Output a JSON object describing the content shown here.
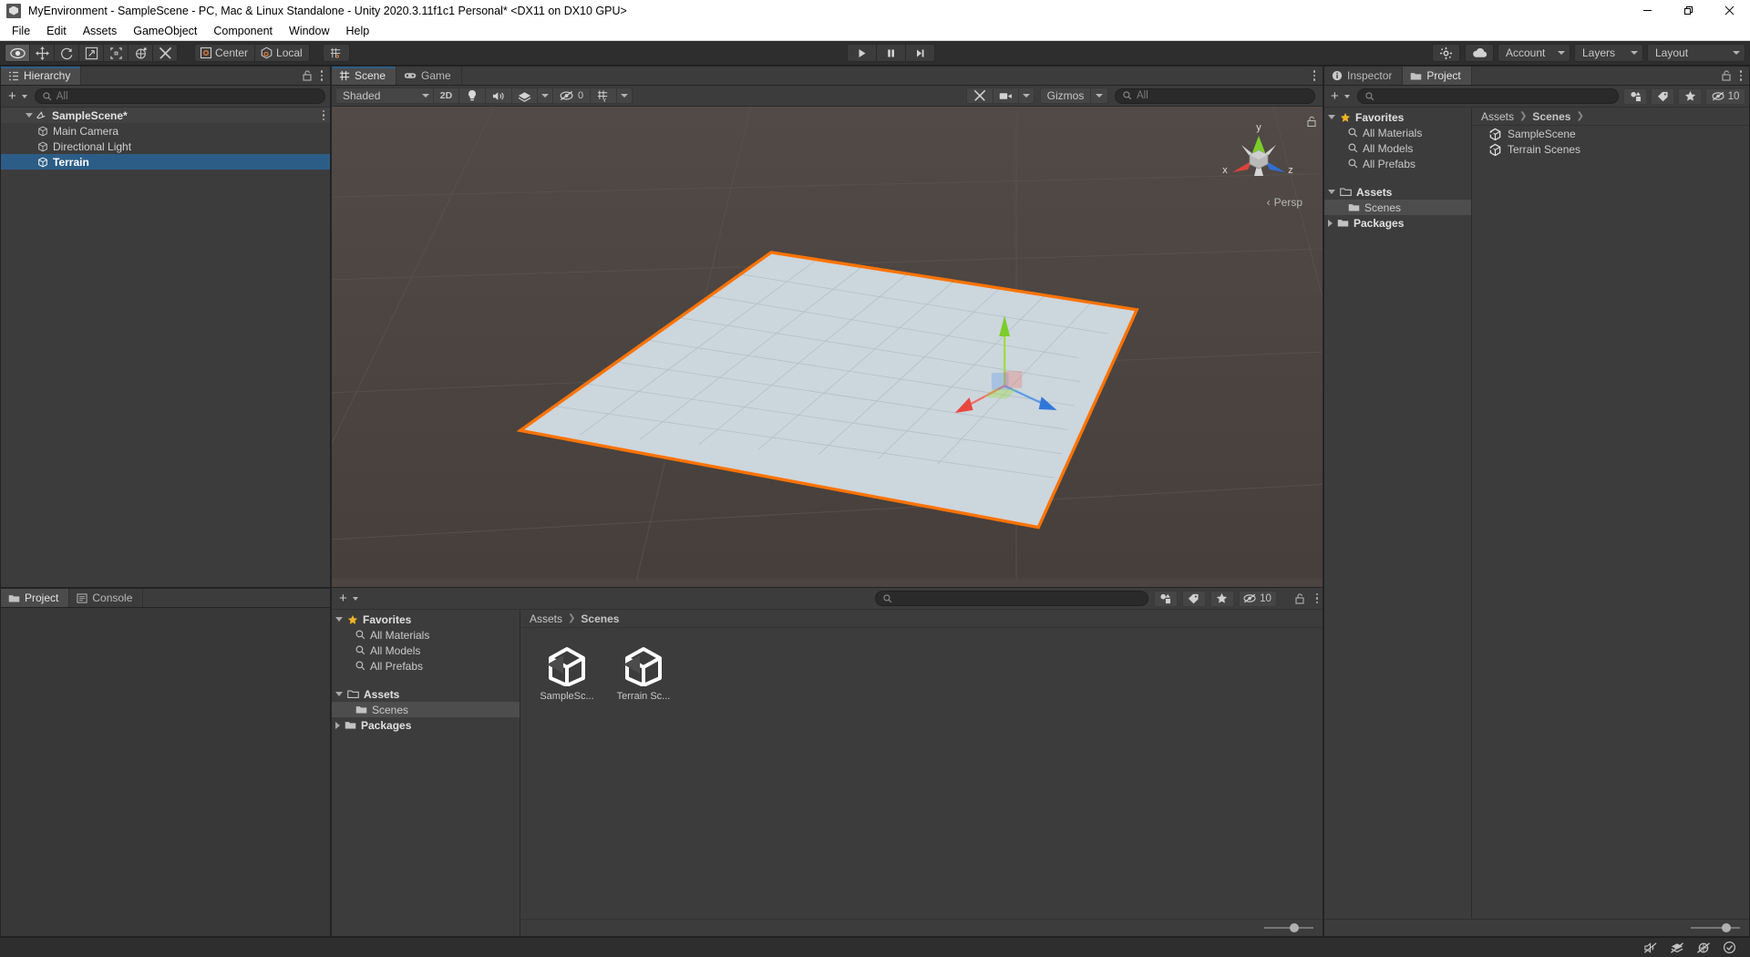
{
  "window": {
    "title": "MyEnvironment - SampleScene - PC, Mac & Linux Standalone - Unity 2020.3.11f1c1 Personal* <DX11 on DX10 GPU>",
    "app_icon": "unity-icon",
    "minimize_label": "—",
    "maximize_label": "❐",
    "close_label": "✕"
  },
  "menubar": {
    "items": [
      {
        "label": "File"
      },
      {
        "label": "Edit"
      },
      {
        "label": "Assets"
      },
      {
        "label": "GameObject"
      },
      {
        "label": "Component"
      },
      {
        "label": "Window"
      },
      {
        "label": "Help"
      }
    ]
  },
  "toolbar": {
    "tools": [
      {
        "name": "hand-tool",
        "icon": "eye-icon",
        "active": true
      },
      {
        "name": "move-tool",
        "icon": "move-arrows-icon",
        "active": false
      },
      {
        "name": "rotate-tool",
        "icon": "rotate-icon",
        "active": false
      },
      {
        "name": "scale-tool",
        "icon": "scale-icon",
        "active": false
      },
      {
        "name": "rect-tool",
        "icon": "rect-transform-icon",
        "active": false
      },
      {
        "name": "transform-tool",
        "icon": "combined-transform-icon",
        "active": false
      },
      {
        "name": "custom-editor-tool",
        "icon": "wrench-screwdriver-icon",
        "active": false
      }
    ],
    "pivot_mode": "Center",
    "pivot_rotation": "Local",
    "grid_snap_icon": "grid-snap-icon",
    "play": "play-icon",
    "pause": "pause-icon",
    "step": "step-icon",
    "collab_icon": "cloud-icon",
    "services_icon": "services-icon",
    "account_label": "Account",
    "layers_label": "Layers",
    "layout_label": "Layout"
  },
  "hierarchy": {
    "tab_label": "Hierarchy",
    "tab_icon": "hierarchy-icon",
    "add_label": "+",
    "search_placeholder": "All",
    "search_value": "",
    "lock_icon": "lock-open-icon",
    "menu_icon": "kebab-icon",
    "items": [
      {
        "label": "SampleScene*",
        "depth": 0,
        "icon": "scene-icon",
        "selected": false,
        "is_scene": true,
        "expanded": true
      },
      {
        "label": "Main Camera",
        "depth": 1,
        "icon": "gameobject-icon",
        "selected": false,
        "is_scene": false
      },
      {
        "label": "Directional Light",
        "depth": 1,
        "icon": "gameobject-icon",
        "selected": false,
        "is_scene": false
      },
      {
        "label": "Terrain",
        "depth": 1,
        "icon": "gameobject-icon",
        "selected": true,
        "is_scene": false
      }
    ]
  },
  "scene_view": {
    "tabs": [
      {
        "label": "Scene",
        "icon": "scene-grid-icon",
        "active": true
      },
      {
        "label": "Game",
        "icon": "gamepad-icon",
        "active": false
      }
    ],
    "draw_mode": "Shaded",
    "mode_2d_label": "2D",
    "lighting_icon": "lightbulb-icon",
    "audio_icon": "speaker-icon",
    "fx_icon": "effects-icon",
    "hidden_count": "0",
    "hidden_icon": "eye-slash-icon",
    "grid_icon": "grid-visibility-icon",
    "tools_icon": "scene-tools-icon",
    "camera_icon": "scene-camera-icon",
    "gizmos_label": "Gizmos",
    "search_placeholder": "All",
    "search_value": "",
    "menu_icon": "kebab-icon",
    "gizmo": {
      "axis_x": "x",
      "axis_y": "y",
      "axis_z": "z",
      "projection_label": "Persp",
      "color_x": "#d9544c",
      "color_y": "#7ccc2a",
      "color_z": "#3d7fd9"
    },
    "selection_outline_color": "#ff7300",
    "terrain_color": "#ccd6dd",
    "background_color": "#4b4441",
    "lock_icon": "lock-open-icon"
  },
  "project_panel": {
    "tabs": [
      {
        "label": "Project",
        "icon": "folder-icon",
        "active": true
      },
      {
        "label": "Console",
        "icon": "console-icon",
        "active": false
      }
    ],
    "add_label": "+",
    "search_placeholder": "",
    "search_value": "",
    "lock_icon": "lock-open-icon",
    "menu_icon": "kebab-icon",
    "filter_type_icon": "filter-by-type-icon",
    "filter_label_icon": "filter-by-label-icon",
    "favorite_icon": "star-icon",
    "hidden_packages_count": "10",
    "hidden_packages_icon": "eye-slash-icon",
    "tree": [
      {
        "label": "Favorites",
        "depth": 0,
        "icon": "star-icon",
        "expanded": true,
        "bold": true,
        "selected": false
      },
      {
        "label": "All Materials",
        "depth": 1,
        "icon": "search-icon",
        "bold": false,
        "selected": false
      },
      {
        "label": "All Models",
        "depth": 1,
        "icon": "search-icon",
        "bold": false,
        "selected": false
      },
      {
        "label": "All Prefabs",
        "depth": 1,
        "icon": "search-icon",
        "bold": false,
        "selected": false
      },
      {
        "label": "Assets",
        "depth": 0,
        "icon": "folder-open-icon",
        "expanded": true,
        "bold": true,
        "selected": false
      },
      {
        "label": "Scenes",
        "depth": 1,
        "icon": "folder-icon",
        "bold": false,
        "selected": true
      },
      {
        "label": "Packages",
        "depth": 0,
        "icon": "folder-icon",
        "expanded": false,
        "bold": true,
        "selected": false
      }
    ],
    "breadcrumb": [
      "Assets",
      "Scenes"
    ],
    "assets": [
      {
        "label": "SampleSc...",
        "icon": "unity-scene-asset-icon"
      },
      {
        "label": "Terrain Sc...",
        "icon": "unity-scene-asset-icon"
      }
    ],
    "zoom_value": 52
  },
  "inspector_panel": {
    "tabs": [
      {
        "label": "Inspector",
        "icon": "info-icon",
        "active": false
      },
      {
        "label": "Project",
        "icon": "folder-icon",
        "active": true
      }
    ],
    "add_label": "+",
    "search_placeholder": "",
    "search_value": "",
    "lock_icon": "lock-open-icon",
    "menu_icon": "kebab-icon",
    "filter_type_icon": "filter-by-type-icon",
    "filter_label_icon": "filter-by-label-icon",
    "favorite_icon": "star-icon",
    "hidden_packages_count": "10",
    "hidden_packages_icon": "eye-slash-icon",
    "tree": [
      {
        "label": "Favorites",
        "depth": 0,
        "icon": "star-icon",
        "expanded": true,
        "bold": true,
        "selected": false
      },
      {
        "label": "All Materials",
        "depth": 1,
        "icon": "search-icon",
        "bold": false,
        "selected": false
      },
      {
        "label": "All Models",
        "depth": 1,
        "icon": "search-icon",
        "bold": false,
        "selected": false
      },
      {
        "label": "All Prefabs",
        "depth": 1,
        "icon": "search-icon",
        "bold": false,
        "selected": false
      },
      {
        "label": "Assets",
        "depth": 0,
        "icon": "folder-open-icon",
        "expanded": true,
        "bold": true,
        "selected": false
      },
      {
        "label": "Scenes",
        "depth": 1,
        "icon": "folder-icon",
        "bold": false,
        "selected": true
      },
      {
        "label": "Packages",
        "depth": 0,
        "icon": "folder-icon",
        "expanded": false,
        "bold": true,
        "selected": false
      }
    ],
    "breadcrumb": [
      "Assets",
      "Scenes"
    ],
    "items": [
      {
        "label": "SampleScene",
        "icon": "unity-scene-asset-icon"
      },
      {
        "label": "Terrain Scenes",
        "icon": "unity-scene-asset-icon"
      }
    ],
    "zoom_value": 62
  },
  "statusbar": {
    "message": "",
    "icons": [
      {
        "name": "mute-audio-icon"
      },
      {
        "name": "layers-disabled-icon"
      },
      {
        "name": "no-gizmos-icon"
      },
      {
        "name": "check-circle-icon"
      }
    ]
  }
}
